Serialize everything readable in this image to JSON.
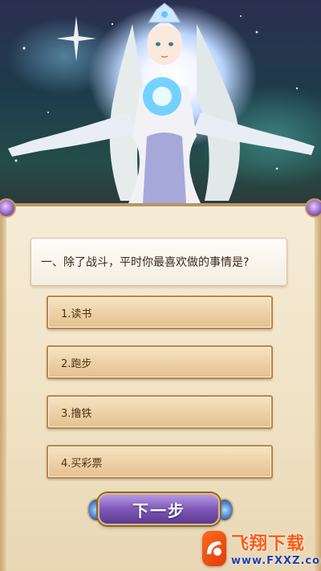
{
  "question": {
    "text": "一、除了战斗，平时你最喜欢做的事情是?"
  },
  "options": [
    {
      "label": "1.读书"
    },
    {
      "label": "2.跑步"
    },
    {
      "label": "3.撸铁"
    },
    {
      "label": "4.买彩票"
    }
  ],
  "next_button": {
    "label": "下一步"
  },
  "watermark": {
    "title": "飞翔下载",
    "url": "www.FXXZ.com"
  },
  "colors": {
    "panel": "#f3e6cc",
    "option_border": "#b8864e",
    "next_button": "#7e58b8",
    "watermark_orange": "#ff5a14",
    "watermark_blue": "#1f3fb0"
  }
}
